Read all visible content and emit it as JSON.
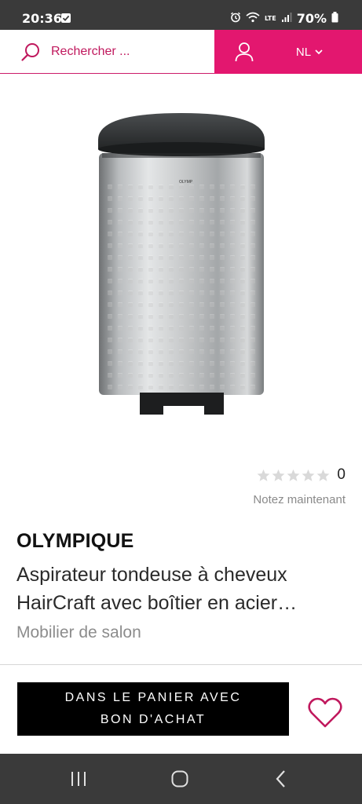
{
  "status_bar": {
    "time": "20:36",
    "battery": "70%",
    "network_label": "LTE",
    "icons": [
      "checkbox-notification-icon",
      "alarm-icon",
      "wifi-icon",
      "signal-icon",
      "battery-icon"
    ]
  },
  "header": {
    "search_placeholder": "Rechercher ...",
    "language": "NL",
    "accent_color": "#e3176f"
  },
  "product": {
    "brand": "OLYMPIQUE",
    "title": "Aspirateur tondeuse à cheveux HairCraft avec boîtier en acier…",
    "title_line1": "Aspirateur tondeuse à cheveux",
    "title_line2": "HairCraft avec boîtier en acier…",
    "category": "Mobilier de salon",
    "rating_count": "0",
    "rating_stars": 0,
    "rate_now": "Notez maintenant",
    "image_logo_text": "OLYMP"
  },
  "actions": {
    "cart_line1": "DANS LE PANIER AVEC",
    "cart_line2": "BON D'ACHAT"
  },
  "nav": {
    "icons": [
      "recent-apps-icon",
      "home-icon",
      "back-icon"
    ]
  }
}
